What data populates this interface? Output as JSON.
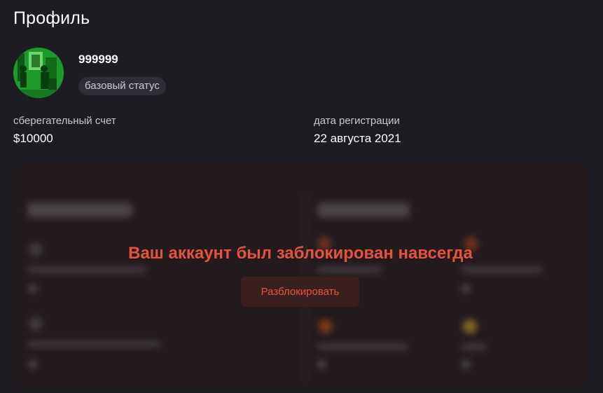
{
  "page": {
    "title": "Профиль"
  },
  "profile": {
    "username": "999999",
    "status": "базовый статус",
    "avatar_icon": "avatar-image-icon"
  },
  "fields": {
    "savings_label": "сберегательный счет",
    "savings_value": "$10000",
    "registration_label": "дата регистрации",
    "registration_value": "22 августа 2021"
  },
  "blocked": {
    "message": "Ваш аккаунт был заблокирован навсегда",
    "unblock_label": "Разблокировать",
    "accent_color": "#e5533d"
  }
}
